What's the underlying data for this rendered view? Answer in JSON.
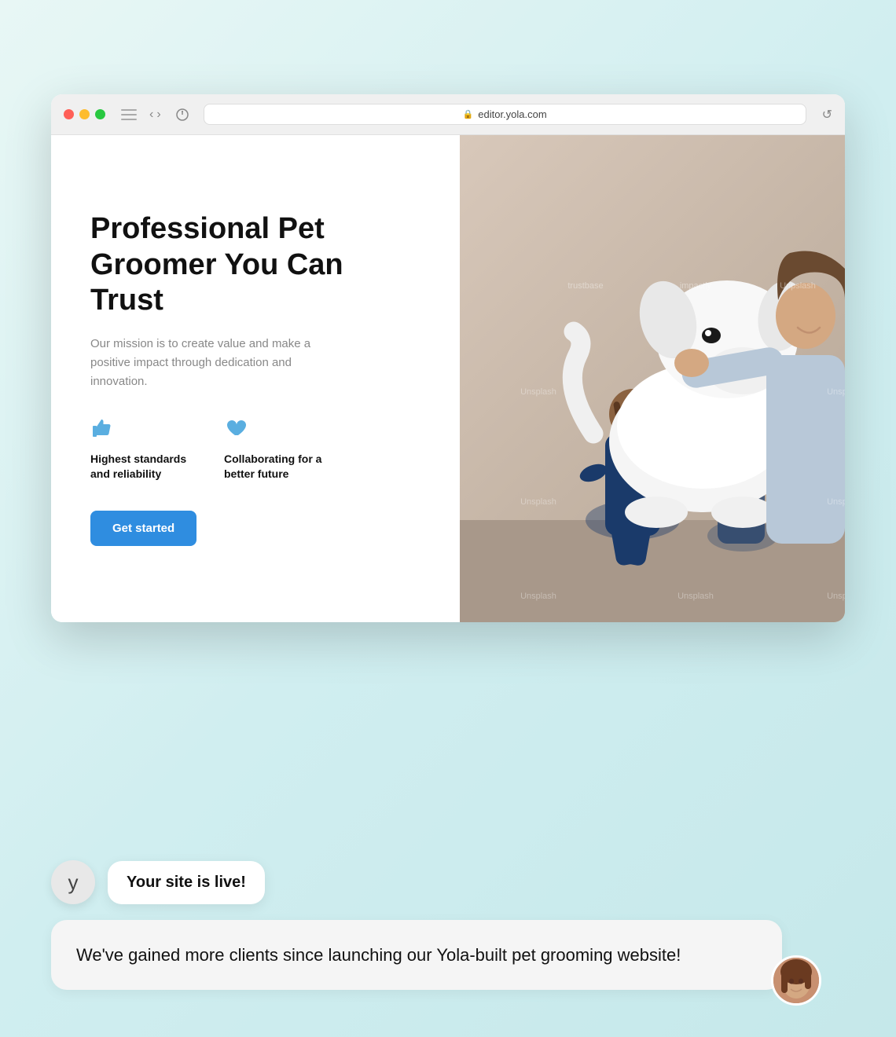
{
  "browser": {
    "url": "editor.yola.com",
    "back_arrow": "‹",
    "forward_arrow": "›",
    "reload": "↺"
  },
  "hero": {
    "title": "Professional Pet Groomer You Can Trust",
    "description": "Our mission is to create value and make a positive impact through dedication and innovation.",
    "feature1_label": "Highest standards and reliability",
    "feature2_label": "Collaborating for a better future",
    "cta_label": "Get started"
  },
  "watermarks": [
    "trustbase",
    "impactly",
    "Unpslash",
    "Unsplash",
    "Unsplash",
    "Unsplash",
    "Unsplash",
    "Unsplash",
    "Unsplash",
    "Unsplash",
    "Unsplash",
    "Unsplash"
  ],
  "chat": {
    "yola_initial": "y",
    "notification_text": "Your site is live!",
    "testimonial_text": "We've gained more clients since launching our Yola-built pet grooming website!"
  }
}
